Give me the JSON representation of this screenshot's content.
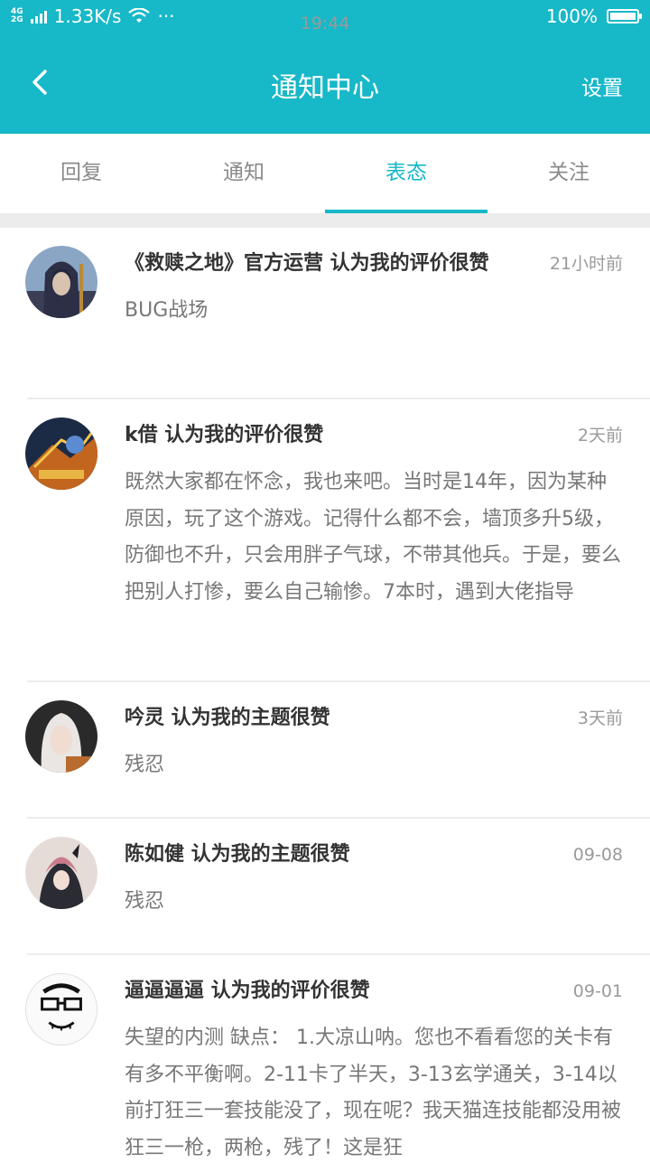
{
  "status_bar": {
    "network": "4G",
    "network2": "2G",
    "speed": "1.33K/s",
    "more": "···",
    "time": "19:44",
    "battery": "100%"
  },
  "header": {
    "title": "通知中心",
    "settings_label": "设置",
    "background_color": "#17b8c8"
  },
  "tabs": [
    {
      "label": "回复",
      "active": false
    },
    {
      "label": "通知",
      "active": false
    },
    {
      "label": "表态",
      "active": true
    },
    {
      "label": "关注",
      "active": false
    }
  ],
  "notifications": [
    {
      "title": "《救赎之地》官方运营 认为我的评价很赞",
      "time": "21小时前",
      "content": "BUG战场",
      "avatar": "hooded-knight-avatar"
    },
    {
      "title": "k借 认为我的评价很赞",
      "time": "2天前",
      "content": "既然大家都在怀念，我也来吧。当时是14年，因为某种原因，玩了这个游戏。记得什么都不会，墙顶多升5级，防御也不升，只会用胖子气球，不带其他兵。于是，要么把别人打惨，要么自己输惨。7本时，遇到大佬指导",
      "avatar": "game-art-avatar"
    },
    {
      "title": "吟灵 认为我的主题很赞",
      "time": "3天前",
      "content": "残忍",
      "avatar": "white-hair-girl-avatar"
    },
    {
      "title": "陈如健 认为我的主题很赞",
      "time": "09-08",
      "content": "残忍",
      "avatar": "anime-character-avatar"
    },
    {
      "title": "逼逼逼逼 认为我的评价很赞",
      "time": "09-01",
      "content": "失望的内测 缺点： 1.大凉山呐。您也不看看您的关卡有有多不平衡啊。2-11卡了半天，3-13玄学通关，3-14以前打狂三一套技能没了，现在呢？我天猫连技能都没用被狂三一枪，两枪，残了！这是狂",
      "avatar": "meme-face-avatar"
    }
  ]
}
